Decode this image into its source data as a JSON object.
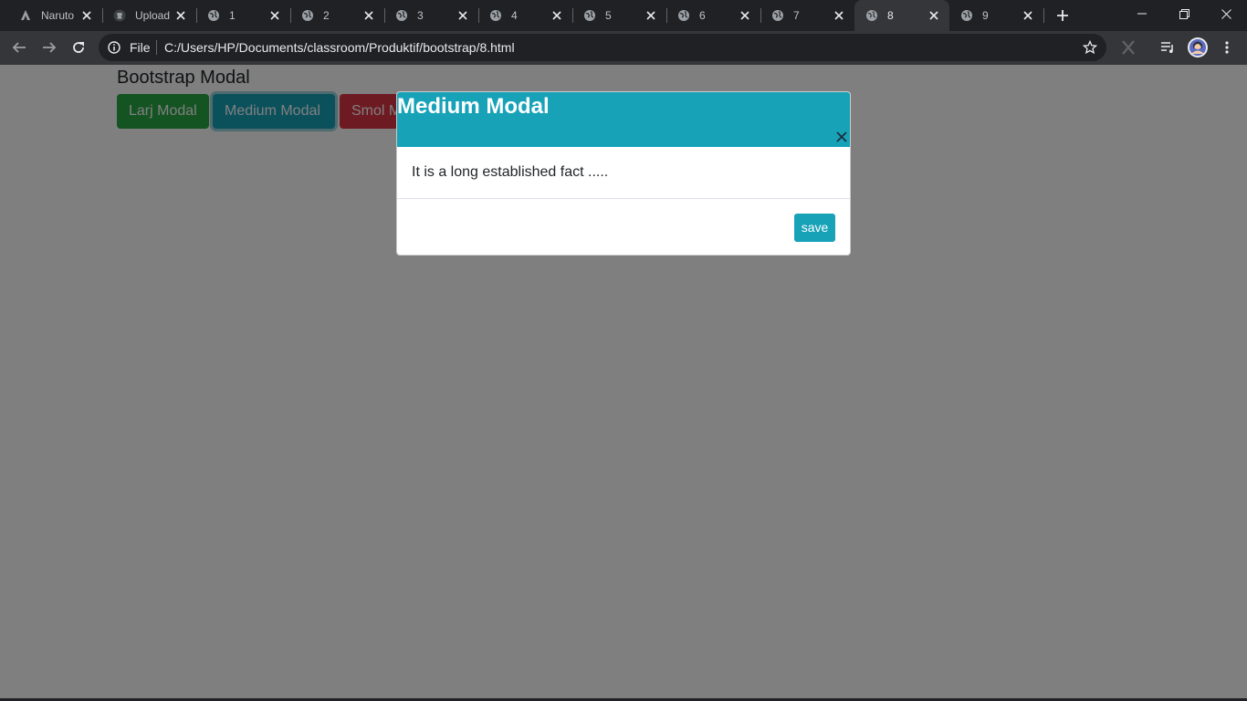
{
  "browser": {
    "tabs": [
      {
        "title": "Naruto",
        "icon": "naruto-icon"
      },
      {
        "title": "Upload",
        "icon": "github-icon"
      },
      {
        "title": "1",
        "icon": "globe-icon"
      },
      {
        "title": "2",
        "icon": "globe-icon"
      },
      {
        "title": "3",
        "icon": "globe-icon"
      },
      {
        "title": "4",
        "icon": "globe-icon"
      },
      {
        "title": "5",
        "icon": "globe-icon"
      },
      {
        "title": "6",
        "icon": "globe-icon"
      },
      {
        "title": "7",
        "icon": "globe-icon"
      },
      {
        "title": "8",
        "icon": "globe-icon",
        "active": true
      },
      {
        "title": "9",
        "icon": "globe-icon"
      }
    ],
    "address": {
      "scheme_label": "File",
      "url": "C:/Users/HP/Documents/classroom/Produktif/bootstrap/8.html"
    }
  },
  "page": {
    "heading": "Bootstrap Modal",
    "buttons": {
      "large": "Larj Modal",
      "medium": "Medium Modal",
      "small": "Smol Modal"
    }
  },
  "modal": {
    "title": "Medium Modal",
    "body": "It is a long established fact .....",
    "save_label": "save"
  },
  "colors": {
    "success": "#28a745",
    "info": "#17a2b8",
    "danger": "#dc3545"
  }
}
